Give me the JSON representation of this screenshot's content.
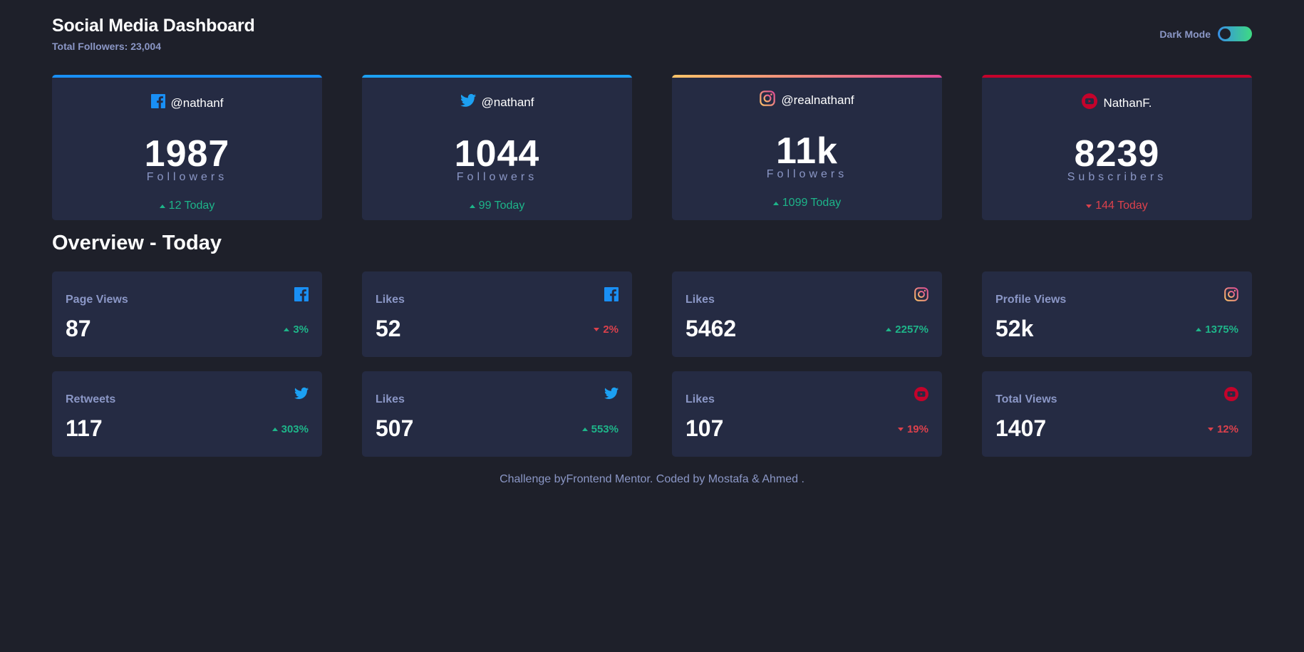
{
  "header": {
    "title": "Social Media Dashboard",
    "total_followers": "Total Followers: 23,004",
    "toggle_label": "Dark Mode"
  },
  "cards": [
    {
      "platform": "facebook",
      "icon": "facebook-icon",
      "handle": "@nathanf",
      "count": "1987",
      "unit": "Followers",
      "today": "12 Today",
      "trend": "up",
      "accent": "#198ff5"
    },
    {
      "platform": "twitter",
      "icon": "twitter-icon",
      "handle": "@nathanf",
      "count": "1044",
      "unit": "Followers",
      "today": "99 Today",
      "trend": "up",
      "accent": "#1ca0f2"
    },
    {
      "platform": "instagram",
      "icon": "instagram-icon",
      "handle": "@realnathanf",
      "count": "11k",
      "unit": "Followers",
      "today": "1099 Today",
      "trend": "up",
      "accent": "#df4996"
    },
    {
      "platform": "youtube",
      "icon": "youtube-icon",
      "handle": "NathanF.",
      "count": "8239",
      "unit": "Subscribers",
      "today": "144 Today",
      "trend": "down",
      "accent": "#c4032b"
    }
  ],
  "overview": {
    "title": "Overview - Today",
    "items": [
      {
        "label": "Page Views",
        "icon": "facebook-icon",
        "value": "87",
        "pct": "3%",
        "trend": "up"
      },
      {
        "label": "Likes",
        "icon": "facebook-icon",
        "value": "52",
        "pct": "2%",
        "trend": "down"
      },
      {
        "label": "Likes",
        "icon": "instagram-icon",
        "value": "5462",
        "pct": "2257%",
        "trend": "up"
      },
      {
        "label": "Profile Views",
        "icon": "instagram-icon",
        "value": "52k",
        "pct": "1375%",
        "trend": "up"
      },
      {
        "label": "Retweets",
        "icon": "twitter-icon",
        "value": "117",
        "pct": "303%",
        "trend": "up"
      },
      {
        "label": "Likes",
        "icon": "twitter-icon",
        "value": "507",
        "pct": "553%",
        "trend": "up"
      },
      {
        "label": "Likes",
        "icon": "youtube-icon",
        "value": "107",
        "pct": "19%",
        "trend": "down"
      },
      {
        "label": "Total Views",
        "icon": "youtube-icon",
        "value": "1407",
        "pct": "12%",
        "trend": "down"
      }
    ]
  },
  "footer": {
    "prefix": "Challenge by",
    "link1": "Frontend Mentor",
    "middle": ". Coded by ",
    "link2": "Mostafa & Ahmed",
    "suffix": " ."
  },
  "colors": {
    "background": "#1e202a",
    "card": "#252b43",
    "muted": "#8b97c6",
    "up": "#1db489",
    "down": "#dc414c"
  }
}
